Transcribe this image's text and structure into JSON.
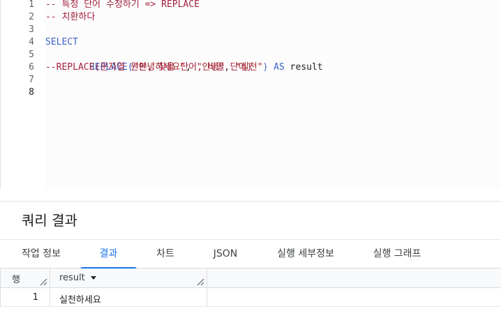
{
  "editor": {
    "line_numbers": [
      "1",
      "2",
      "3",
      "4",
      "5",
      "6",
      "7",
      "8"
    ],
    "active_line": "8",
    "lines": {
      "l1": "-- 특정 단어 수정하기 => REPLACE",
      "l2": "-- 치환하다",
      "l4": "SELECT",
      "l5": {
        "fn": "REPLACE(",
        "arg1": "\"안녕하세요\"",
        "sep1": ", ",
        "arg2": "\"안녕\"",
        "sep2": ", ",
        "arg3": "\"실천\"",
        "close": ")",
        "as_kw": " AS",
        "alias": " result"
      },
      "l6": "--REPLACE(문자열 원본, 찾을 단어, 바꿀 단어)"
    }
  },
  "results": {
    "title": "쿼리 결과",
    "tabs": [
      {
        "label": "작업 정보"
      },
      {
        "label": "결과"
      },
      {
        "label": "차트"
      },
      {
        "label": "JSON"
      },
      {
        "label": "실행 세부정보"
      },
      {
        "label": "실행 그래프"
      }
    ],
    "active_tab": "결과",
    "table": {
      "row_header": "행",
      "columns": [
        "result"
      ],
      "rows": [
        {
          "row_num": "1",
          "result": "실천하세요"
        }
      ]
    }
  },
  "colors": {
    "accent": "#1a73e8",
    "comment": "#a3213e",
    "keyword": "#3e62c9",
    "string": "#a5282c"
  },
  "icons": [
    "sort-down-icon",
    "resize-handle-icon"
  ]
}
